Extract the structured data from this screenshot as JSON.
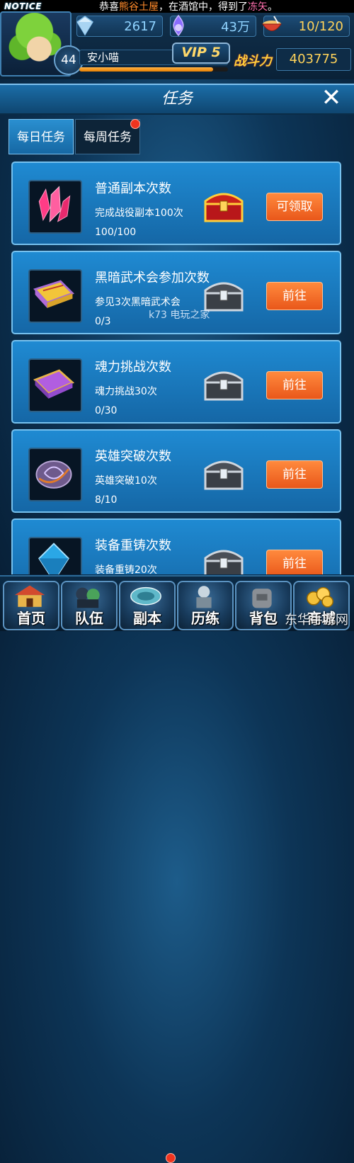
{
  "notice": {
    "tag": "NOTICE",
    "prefix": "恭喜",
    "player": "熊谷土屋",
    "middle": "，在酒馆中，得到了",
    "item": "冻矢",
    "suffix": "。"
  },
  "resources": {
    "crystal": "2617",
    "soul": "43万",
    "stamina": "10/120"
  },
  "player": {
    "level": "44",
    "name": "安小喵",
    "vip": "VIP 5",
    "power_label": "战斗力",
    "power": "403775",
    "exp_progress": 0.9
  },
  "panel": {
    "title": "任务",
    "tabs": [
      {
        "label": "每日任务",
        "active": true
      },
      {
        "label": "每周任务",
        "active": false,
        "has_dot": true
      }
    ]
  },
  "tasks": [
    {
      "title": "普通副本次数",
      "desc": "完成战役副本100次",
      "progress": "100/100",
      "button": "可领取",
      "icon": "crystal-icon",
      "chest": "gold-chest-icon"
    },
    {
      "title": "黑暗武术会参加次数",
      "desc": "参见3次黑暗武术会",
      "progress": "0/3",
      "button": "前往",
      "icon": "yellow-book-icon",
      "chest": "silver-chest-icon"
    },
    {
      "title": "魂力挑战次数",
      "desc": "魂力挑战30次",
      "progress": "0/30",
      "button": "前往",
      "icon": "purple-book-icon",
      "chest": "silver-chest-icon"
    },
    {
      "title": "英雄突破次数",
      "desc": "英雄突破10次",
      "progress": "8/10",
      "button": "前往",
      "icon": "rune-stone-icon",
      "chest": "silver-chest-icon"
    },
    {
      "title": "装备重铸次数",
      "desc": "装备重铸20次",
      "progress": "",
      "button": "前往",
      "icon": "blue-gem-icon",
      "chest": "silver-chest-icon"
    }
  ],
  "watermark": "k73 电玩之家",
  "nav": [
    {
      "label": "首页"
    },
    {
      "label": "队伍"
    },
    {
      "label": "副本",
      "has_dot": true
    },
    {
      "label": "历练"
    },
    {
      "label": "背包"
    },
    {
      "label": "商城"
    }
  ],
  "site_mark": "东华手游网",
  "colors": {
    "row_bg": "#1a7bc2",
    "button_orange": "#f06a26",
    "power_gold": "#ffd35a",
    "notice_highlight": "#ff8a2a"
  }
}
